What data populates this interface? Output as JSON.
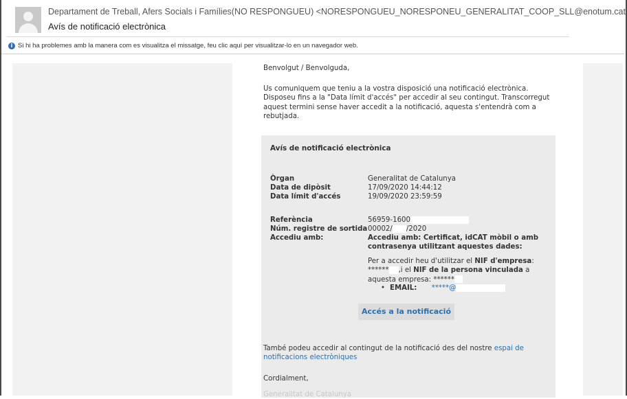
{
  "header": {
    "sender": "Departament de Treball, Afers Socials i Famílies(NO RESPONGUEU) <NORESPONGUEU_NORESPONEU_GENERALITAT_COOP_SLL@enotum.cat>",
    "subject": "Avís de notificació electrònica",
    "info_text": "Si hi ha problemes amb la manera com es visualitza el missatge, feu clic aquí per visualitzar-lo en un navegador web."
  },
  "body": {
    "greeting": "Benvolgut / Benvolguda,",
    "intro": "Us comuniquem que teniu a la vostra disposició una notificació electrònica. Disposeu fins a la \"Data límit d'accés\" per accedir al seu contingut. Transcorregut aquest termini sense haver accedit a la notificació, aquesta s'entendrà com a rebutjada.",
    "notice": {
      "title": "Avís de notificació electrònica",
      "organ_label": "Òrgan",
      "organ_value": "Generalitat de Catalunya",
      "deposit_label": "Data de dipòsit",
      "deposit_value": "17/09/2020 14:44:12",
      "limit_label": "Data límit d'accés",
      "limit_value": "19/09/2020 23:59:59",
      "ref_label": "Referència",
      "ref_value": "56959-1600",
      "reg_label": "Núm. registre de sortida",
      "reg_value_a": "00002/",
      "reg_value_b": "/2020",
      "access_label": "Accediu amb:",
      "access_value": "Accediu amb: Certificat, idCAT mòbil o amb contrasenya utilitzant aquestes dades:",
      "nif_text_1": "Per a accedir heu d'utilitzar el ",
      "nif_bold_1": "NIF d'empresa",
      "nif_text_2": ":",
      "nif_mask_1": "******",
      "nif_text_3": ",i el ",
      "nif_bold_2": "NIF de la persona vinculada",
      "nif_text_4": " a aquesta empresa: ",
      "nif_mask_2": "******",
      "email_bullet": "•",
      "email_label": "EMAIL:",
      "email_value": "*****@",
      "button": "Accés a la notificació"
    },
    "also_text": "També podeu accedir al contingut de la notificació des del nostre ",
    "also_link": "espai de notificacions electròniques",
    "closing": "Cordialment,",
    "signature_faded": "Generalitat de Catalunya"
  }
}
